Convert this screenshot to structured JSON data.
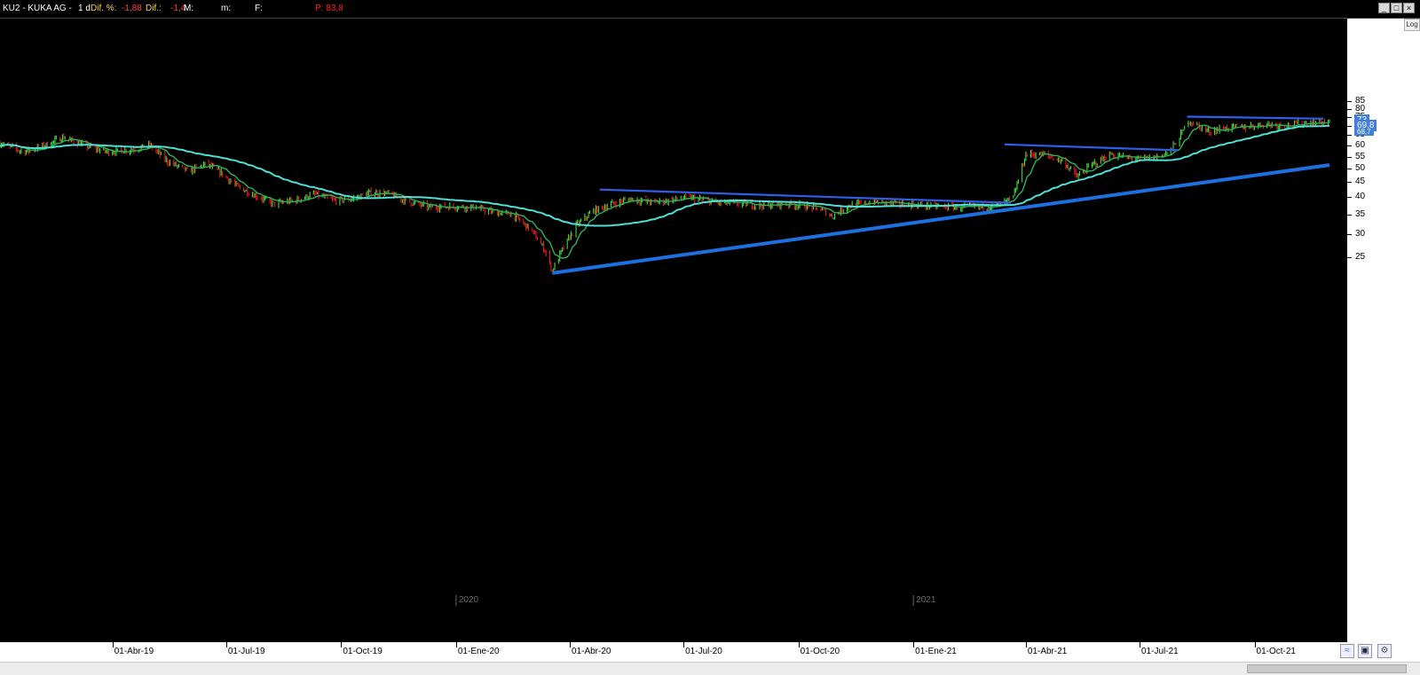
{
  "header": {
    "symbol": "KU2 - KUKA AG -",
    "period": "1 d",
    "dif_pct_label": "Dif. %:",
    "dif_pct_value": "-1,88",
    "dif_label": "Dif.:",
    "dif_value": "-1,4",
    "m_label": "M:",
    "m2_label": "m:",
    "f_label": "F:",
    "p_label": "P: 83,8"
  },
  "controls": {
    "log_label": "Log",
    "minimize": "_",
    "maximize": "□",
    "close": "×"
  },
  "colors": {
    "up": "#3ddc3d",
    "down": "#e81818",
    "ma_short": "#2bb35a",
    "ma_long": "#4fe0d8",
    "trendline": "#1e6fe0",
    "resistance": "#2f5fe8",
    "price_box": "#3f7fd8"
  },
  "chart_data": {
    "type": "candlestick",
    "scale": "log",
    "ylim": [
      20.5,
      86
    ],
    "y_ticks": [
      25,
      30,
      35,
      40,
      45,
      50,
      55,
      60,
      65,
      70,
      75,
      80,
      85
    ],
    "x_tick_labels": [
      "01-Abr-19",
      "01-Jul-19",
      "01-Oct-19",
      "01-Ene-20",
      "01-Abr-20",
      "01-Jul-20",
      "01-Oct-20",
      "01-Ene-21",
      "01-Abr-21",
      "01-Jul-21",
      "01-Oct-21"
    ],
    "year_markers": [
      "2020",
      "2021"
    ],
    "last_price": "73",
    "ma_price": "69,8",
    "ma_price_2": "68,7",
    "price_path": [
      [
        "2019-01-02",
        61
      ],
      [
        "2019-01-20",
        57
      ],
      [
        "2019-02-06",
        60
      ],
      [
        "2019-02-20",
        64
      ],
      [
        "2019-03-10",
        60
      ],
      [
        "2019-03-28",
        57
      ],
      [
        "2019-04-15",
        58
      ],
      [
        "2019-05-01",
        60
      ],
      [
        "2019-05-15",
        53
      ],
      [
        "2019-06-01",
        49
      ],
      [
        "2019-06-15",
        52
      ],
      [
        "2019-06-28",
        48
      ],
      [
        "2019-07-08",
        44
      ],
      [
        "2019-07-22",
        41
      ],
      [
        "2019-08-08",
        38
      ],
      [
        "2019-08-25",
        39
      ],
      [
        "2019-09-10",
        41
      ],
      [
        "2019-09-25",
        39
      ],
      [
        "2019-10-10",
        39.5
      ],
      [
        "2019-10-25",
        41.5
      ],
      [
        "2019-11-08",
        41
      ],
      [
        "2019-11-25",
        38.5
      ],
      [
        "2019-12-10",
        37
      ],
      [
        "2019-12-28",
        37.2
      ],
      [
        "2020-01-15",
        37
      ],
      [
        "2020-02-01",
        35.5
      ],
      [
        "2020-02-15",
        35
      ],
      [
        "2020-03-01",
        31
      ],
      [
        "2020-03-12",
        26.5
      ],
      [
        "2020-03-18",
        22.5
      ],
      [
        "2020-03-25",
        26
      ],
      [
        "2020-04-06",
        32
      ],
      [
        "2020-04-20",
        36
      ],
      [
        "2020-05-05",
        38
      ],
      [
        "2020-05-20",
        39.5
      ],
      [
        "2020-06-05",
        38.5
      ],
      [
        "2020-06-20",
        39
      ],
      [
        "2020-07-05",
        40
      ],
      [
        "2020-07-25",
        38.5
      ],
      [
        "2020-08-15",
        38
      ],
      [
        "2020-09-01",
        37.5
      ],
      [
        "2020-09-20",
        38
      ],
      [
        "2020-10-05",
        37.5
      ],
      [
        "2020-10-18",
        36.5
      ],
      [
        "2020-10-28",
        34.5
      ],
      [
        "2020-11-10",
        37.5
      ],
      [
        "2020-12-01",
        38.5
      ],
      [
        "2020-12-20",
        38
      ],
      [
        "2021-01-10",
        37.5
      ],
      [
        "2021-02-05",
        37
      ],
      [
        "2021-02-25",
        37
      ],
      [
        "2021-03-12",
        37.8
      ],
      [
        "2021-03-22",
        40
      ],
      [
        "2021-03-28",
        49
      ],
      [
        "2021-04-01",
        56
      ],
      [
        "2021-04-15",
        56
      ],
      [
        "2021-05-01",
        53
      ],
      [
        "2021-05-12",
        47
      ],
      [
        "2021-05-25",
        52
      ],
      [
        "2021-06-08",
        56
      ],
      [
        "2021-06-20",
        54.5
      ],
      [
        "2021-07-01",
        54
      ],
      [
        "2021-07-15",
        55
      ],
      [
        "2021-07-25",
        57
      ],
      [
        "2021-08-02",
        64
      ],
      [
        "2021-08-09",
        73
      ],
      [
        "2021-08-25",
        67
      ],
      [
        "2021-09-10",
        69
      ],
      [
        "2021-09-25",
        69.5
      ],
      [
        "2021-10-10",
        71
      ],
      [
        "2021-10-25",
        70
      ],
      [
        "2021-11-05",
        71
      ],
      [
        "2021-11-16",
        72
      ]
    ],
    "annotations": [
      {
        "type": "support_trendline",
        "from": [
          "2020-03-18",
          22.1
        ],
        "to": [
          "2021-11-30",
          51.5
        ]
      },
      {
        "type": "resistance",
        "from": [
          "2020-04-25",
          42.5
        ],
        "to": [
          "2021-03-20",
          38.3
        ]
      },
      {
        "type": "resistance",
        "from": [
          "2021-03-15",
          60.5
        ],
        "to": [
          "2021-08-01",
          57.8
        ]
      },
      {
        "type": "resistance",
        "from": [
          "2021-08-08",
          75.2
        ],
        "to": [
          "2021-11-25",
          74.0
        ]
      }
    ]
  }
}
